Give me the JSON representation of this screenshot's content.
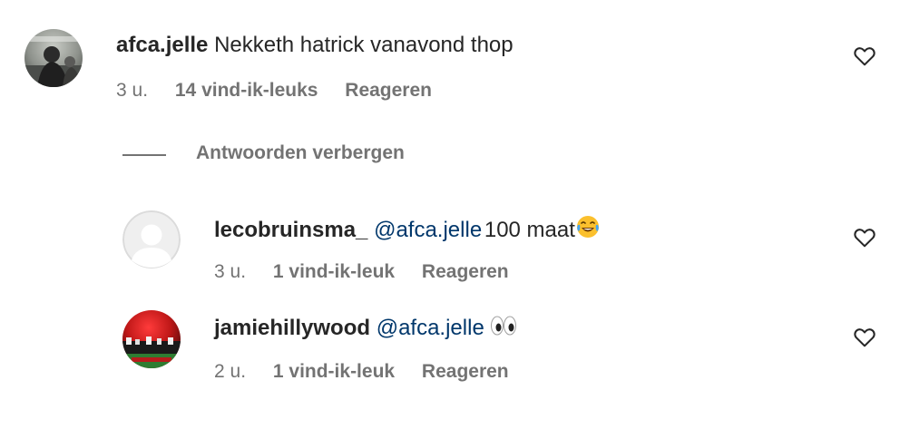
{
  "comments": [
    {
      "username": "afca.jelle",
      "text": "Nekketh hatrick vanavond thop",
      "time": "3 u.",
      "likes": "14 vind-ik-leuks",
      "reply": "Reageren"
    }
  ],
  "hide_replies_label": "Antwoorden verbergen",
  "replies": [
    {
      "username": "lecobruinsma_",
      "mention": "@afca.jelle",
      "text": "100 maat",
      "emoji": "laughing-crying-emoji",
      "time": "3 u.",
      "likes": "1 vind-ik-leuk",
      "reply": "Reageren"
    },
    {
      "username": "jamiehillywood",
      "mention": "@afca.jelle",
      "text": "",
      "emoji": "eyes-emoji",
      "time": "2 u.",
      "likes": "1 vind-ik-leuk",
      "reply": "Reageren"
    }
  ],
  "icons": {
    "like": "heart-icon",
    "default_avatar": "default-avatar-icon"
  },
  "colors": {
    "text": "#262626",
    "secondary": "#737373",
    "mention": "#00376b",
    "background": "#ffffff"
  }
}
